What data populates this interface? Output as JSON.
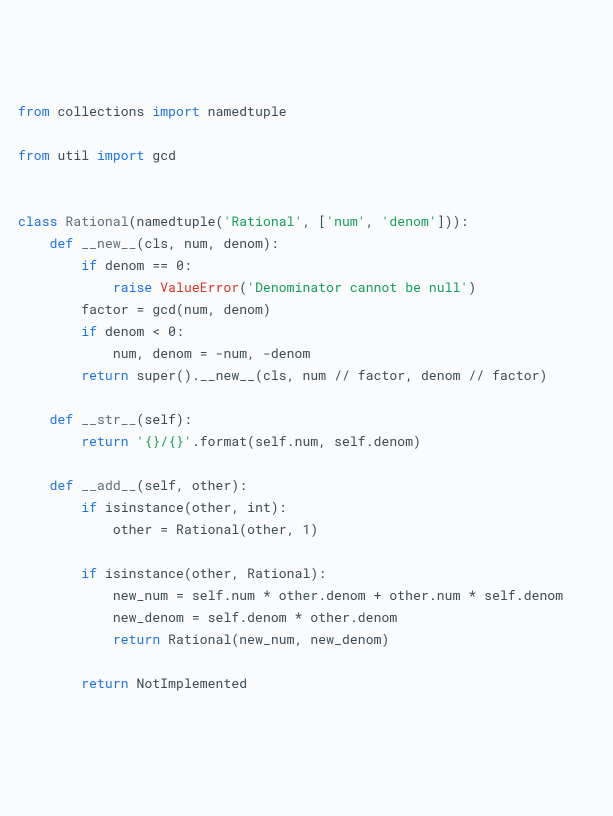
{
  "kw_from": "from",
  "kw_import": "import",
  "kw_class": "class",
  "kw_def": "def",
  "kw_if": "if",
  "kw_raise": "raise",
  "kw_return": "return",
  "id_collections": "collections",
  "id_namedtuple": "namedtuple",
  "id_util": "util",
  "id_gcd": "gcd",
  "cls_rational": "Rational",
  "str_rational": "'Rational'",
  "str_num": "'num'",
  "str_denom": "'denom'",
  "fn_new": "__new__",
  "params_new": "(cls, num, denom):",
  "cond_denom_zero": "denom == ",
  "num_zero": "0",
  "err_value": "ValueError",
  "str_denom_null": "'Denominator cannot be null'",
  "line_factor": "factor = gcd(num, denom)",
  "cond_denom_neg": "denom < ",
  "line_negate": "num, denom = -num, -denom",
  "id_super": "super",
  "call_super_new": "().__new__(cls, num // factor, denom // factor)",
  "fn_str": "__str__",
  "params_str": "(self):",
  "str_format": "'{}/{}'",
  "call_format": ".format(self.num, self.denom)",
  "fn_add": "__add__",
  "params_add": "(self, other):",
  "id_isinstance": "isinstance",
  "call_isinst_int": "(other, int):",
  "line_other_rational": "other = Rational(other, ",
  "num_one": "1",
  "call_isinst_rational": "(other, Rational):",
  "line_new_num": "new_num = self.num * other.denom + other.num * self.denom",
  "line_new_denom": "new_denom = self.denom * other.denom",
  "call_rational_new": "Rational(new_num, new_denom)",
  "id_notimpl": "NotImplemented"
}
